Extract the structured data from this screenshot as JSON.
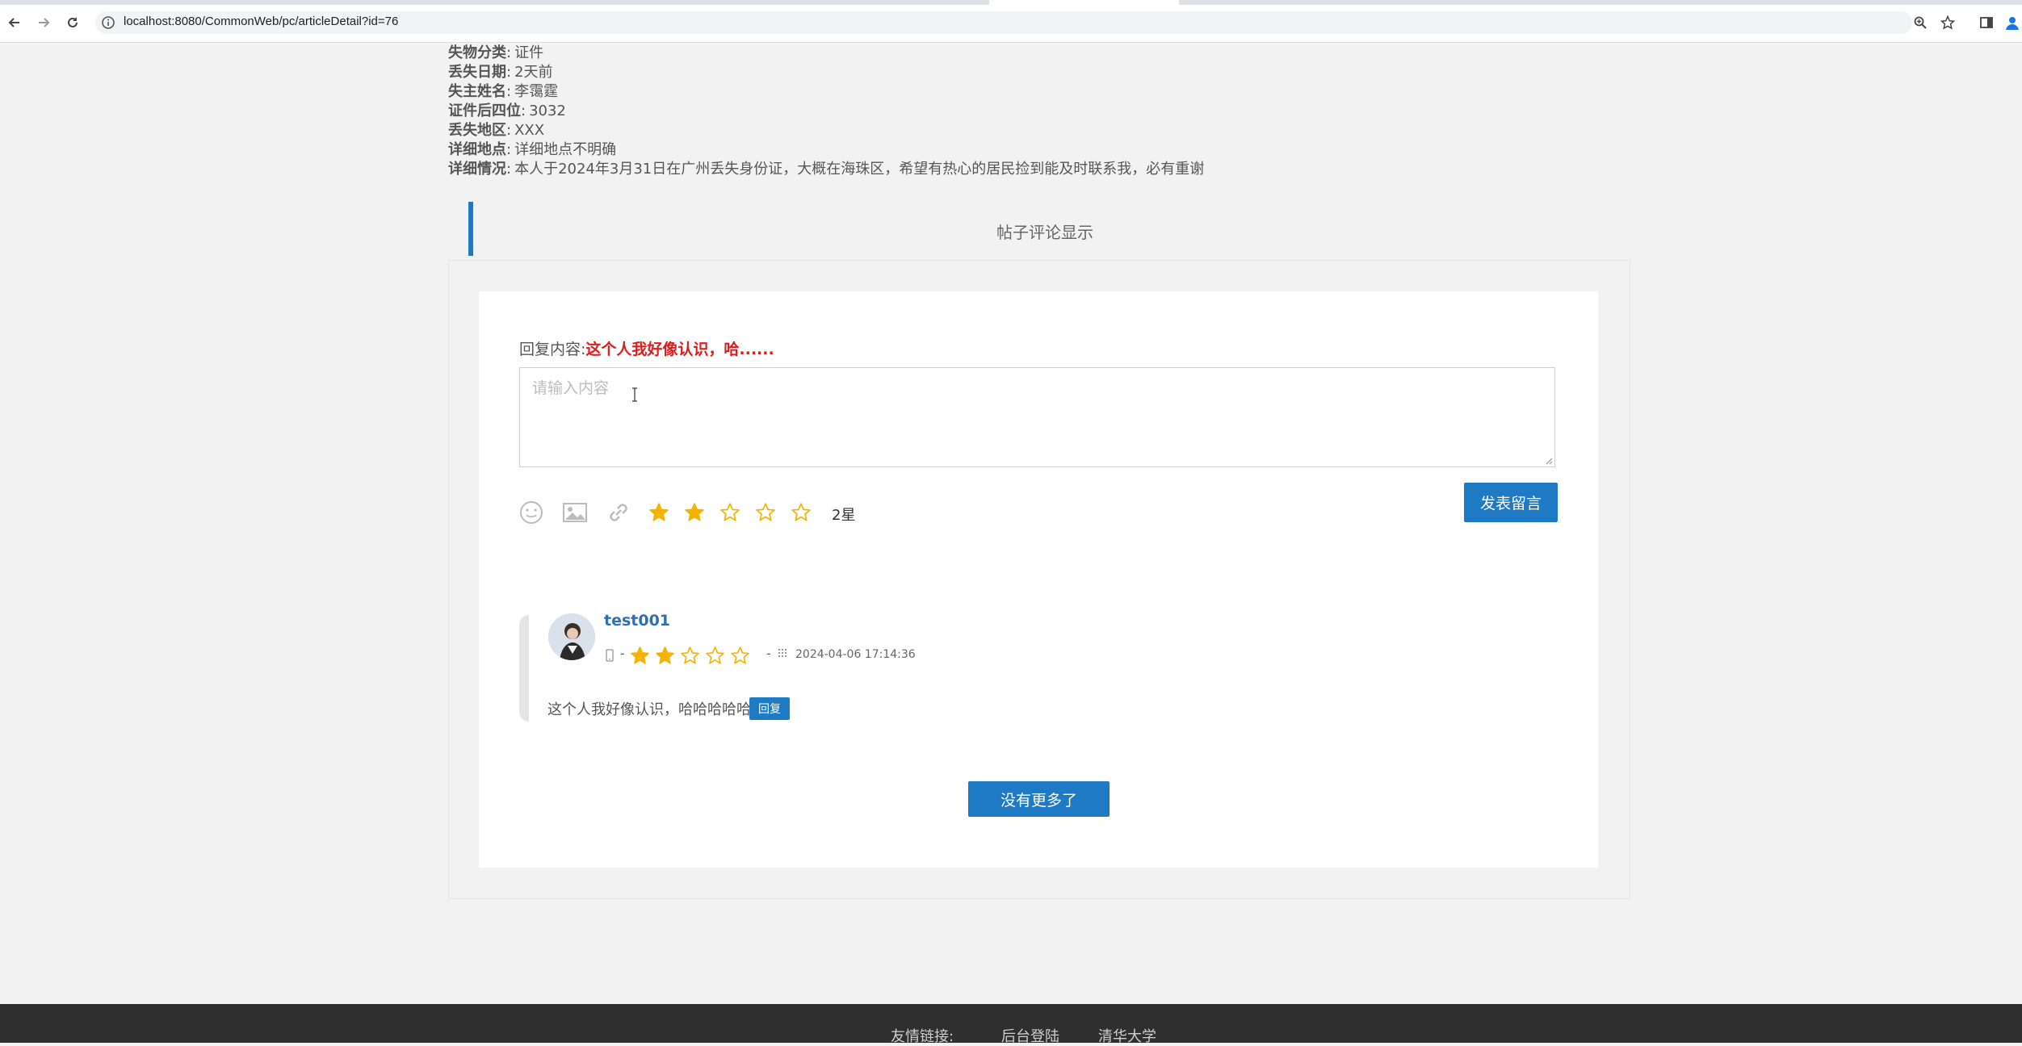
{
  "browser": {
    "url": "localhost:8080/CommonWeb/pc/articleDetail?id=76"
  },
  "detail": {
    "rows": [
      {
        "label": "失物分类",
        "value": "证件"
      },
      {
        "label": "丢失日期",
        "value": "2天前"
      },
      {
        "label": "失主姓名",
        "value": "李霭霆"
      },
      {
        "label": "证件后四位",
        "value": "3032"
      },
      {
        "label": "丢失地区",
        "value": "XXX"
      },
      {
        "label": "详细地点",
        "value": "详细地点不明确"
      },
      {
        "label": "详细情况",
        "value": "本人于2024年3月31日在广州丢失身份证，大概在海珠区，希望有热心的居民捡到能及时联系我，必有重谢"
      }
    ],
    "separator": ":"
  },
  "comments_section": {
    "heading": "帖子评论显示",
    "reply_label": "回复内容:",
    "reply_quote": "这个人我好像认识，哈......",
    "textarea_placeholder": "请输入内容",
    "rating_text": "2星",
    "rating": 2,
    "rating_max": 5,
    "post_button": "发表留言",
    "more_button": "没有更多了"
  },
  "comment": {
    "username": "test001",
    "dash": "-",
    "rating": 2,
    "rating_max": 5,
    "time": "2024-04-06 17:14:36",
    "text": "这个人我好像认识，哈哈哈哈哈",
    "reply_button": "回复"
  },
  "footer": {
    "links_label": "友情链接:",
    "links": [
      "后台登陆",
      "清华大学"
    ]
  },
  "colors": {
    "accent": "#1e7ac5",
    "star": "#f5b301",
    "quote_red": "#e01b1b"
  },
  "icons": [
    "back-arrow-icon",
    "forward-arrow-icon",
    "reload-icon",
    "info-icon",
    "zoom-icon",
    "bookmark-star-icon",
    "sidepanel-icon",
    "profile-icon",
    "emoji-icon",
    "image-icon",
    "link-icon",
    "star-icon",
    "device-icon",
    "calendar-icon"
  ]
}
